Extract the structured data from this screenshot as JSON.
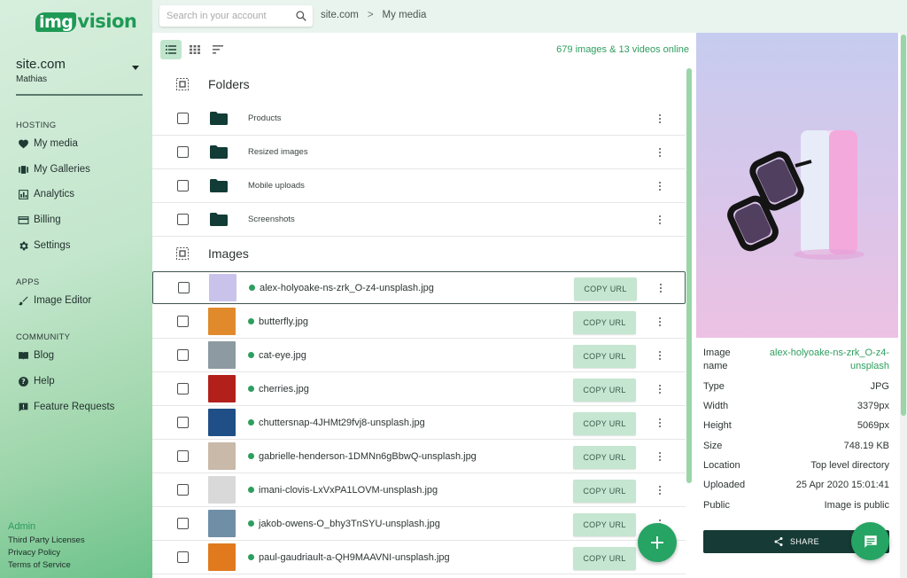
{
  "brand": {
    "logo_prefix": "img",
    "logo_suffix": "vision"
  },
  "site": {
    "name": "site.com",
    "user": "Mathias"
  },
  "sidebar": {
    "sections": [
      {
        "title": "HOSTING",
        "items": [
          {
            "label": "My media",
            "icon": "heart-icon"
          },
          {
            "label": "My Galleries",
            "icon": "galleries-icon"
          },
          {
            "label": "Analytics",
            "icon": "chart-icon"
          },
          {
            "label": "Billing",
            "icon": "card-icon"
          },
          {
            "label": "Settings",
            "icon": "gear-icon"
          }
        ]
      },
      {
        "title": "APPS",
        "items": [
          {
            "label": "Image Editor",
            "icon": "brush-icon"
          }
        ]
      },
      {
        "title": "COMMUNITY",
        "items": [
          {
            "label": "Blog",
            "icon": "book-icon"
          },
          {
            "label": "Help",
            "icon": "help-icon"
          },
          {
            "label": "Feature Requests",
            "icon": "feedback-icon"
          }
        ]
      }
    ],
    "footer": {
      "admin": "Admin",
      "links": [
        "Third Party Licenses",
        "Privacy Policy",
        "Terms of Service"
      ]
    }
  },
  "search": {
    "placeholder": "Search in your account"
  },
  "breadcrumb": {
    "root": "site.com",
    "separator": ">",
    "current": "My media"
  },
  "toolbar": {
    "count_text": "679 images & 13 videos online"
  },
  "folders": {
    "title": "Folders",
    "items": [
      "Products",
      "Resized images",
      "Mobile uploads",
      "Screenshots"
    ]
  },
  "images": {
    "title": "Images",
    "copy_label": "COPY URL",
    "items": [
      {
        "name": "alex-holyoake-ns-zrk_O-z4-unsplash.jpg",
        "thumb_color": "#c9c3ec"
      },
      {
        "name": "butterfly.jpg",
        "thumb_color": "#e08a2c"
      },
      {
        "name": "cat-eye.jpg",
        "thumb_color": "#8d9aa1"
      },
      {
        "name": "cherries.jpg",
        "thumb_color": "#b3201c"
      },
      {
        "name": "chuttersnap-4JHMt29fvj8-unsplash.jpg",
        "thumb_color": "#1f4f86"
      },
      {
        "name": "gabrielle-henderson-1DMNn6gBbwQ-unsplash.jpg",
        "thumb_color": "#c8b9a9"
      },
      {
        "name": "imani-clovis-LxVxPA1LOVM-unsplash.jpg",
        "thumb_color": "#d9d9d9"
      },
      {
        "name": "jakob-owens-O_bhy3TnSYU-unsplash.jpg",
        "thumb_color": "#6f8fa6"
      },
      {
        "name": "paul-gaudriault-a-QH9MAAVNI-unsplash.jpg",
        "thumb_color": "#e07a1d"
      }
    ]
  },
  "details": {
    "rows": [
      {
        "key": "Image name",
        "value": "alex-holyoake-ns-zrk_O-z4-unsplash",
        "accent": true
      },
      {
        "key": "Type",
        "value": "JPG"
      },
      {
        "key": "Width",
        "value": "3379px"
      },
      {
        "key": "Height",
        "value": "5069px"
      },
      {
        "key": "Size",
        "value": "748.19 KB"
      },
      {
        "key": "Location",
        "value": "Top level directory"
      },
      {
        "key": "Uploaded",
        "value": "25 Apr 2020 15:01:41"
      },
      {
        "key": "Public",
        "value": "Image is public"
      }
    ],
    "share_label": "SHARE"
  },
  "colors": {
    "accent": "#2e9e5e",
    "dark": "#163a35",
    "button_light": "#c5e6d0"
  }
}
